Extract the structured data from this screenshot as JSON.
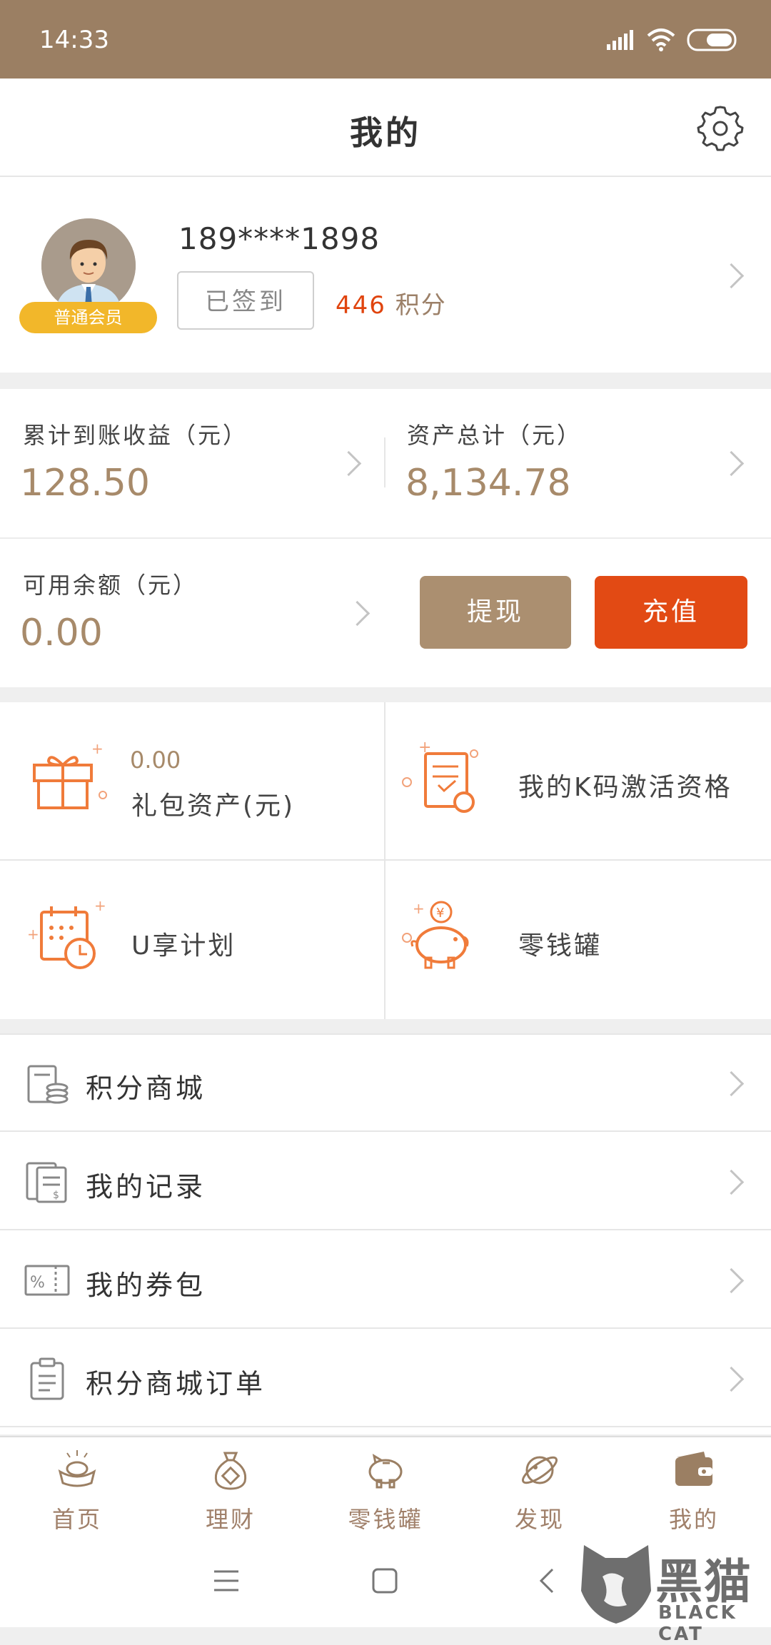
{
  "status_bar": {
    "time": "14:33"
  },
  "header": {
    "title": "我的"
  },
  "profile": {
    "phone": "189****1898",
    "member_level": "普通会员",
    "checkin_label": "已签到",
    "points_value": "446",
    "points_unit": "积分"
  },
  "balances": {
    "cumulative_label": "累计到账收益（元）",
    "cumulative_value": "128.50",
    "total_assets_label": "资产总计（元）",
    "total_assets_value": "8,134.78",
    "available_label": "可用余额（元）",
    "available_value": "0.00",
    "withdraw_label": "提现",
    "recharge_label": "充值"
  },
  "grid": {
    "gift": {
      "value": "0.00",
      "label": "礼包资产(元)"
    },
    "kcode": {
      "label": "我的K码激活资格"
    },
    "uplan": {
      "label": "U享计划"
    },
    "piggy": {
      "label": "零钱罐"
    }
  },
  "menu": {
    "items": [
      {
        "label": "积分商城",
        "icon": "coin-stack-icon"
      },
      {
        "label": "我的记录",
        "icon": "records-icon"
      },
      {
        "label": "我的券包",
        "icon": "coupon-icon"
      },
      {
        "label": "积分商城订单",
        "icon": "clipboard-icon"
      }
    ]
  },
  "bottom_nav": {
    "items": [
      {
        "label": "首页",
        "icon": "ingot-icon"
      },
      {
        "label": "理财",
        "icon": "money-bag-icon"
      },
      {
        "label": "零钱罐",
        "icon": "piggy-bank-icon"
      },
      {
        "label": "发现",
        "icon": "planet-icon"
      },
      {
        "label": "我的",
        "icon": "wallet-icon"
      }
    ]
  },
  "watermark": {
    "brand": "黑猫",
    "sub": "BLACK CAT"
  },
  "colors": {
    "brand_brown": "#9b7f63",
    "accent_orange": "#e24a14",
    "badge_yellow": "#f2b72a",
    "value_tan": "#a78a6a"
  }
}
